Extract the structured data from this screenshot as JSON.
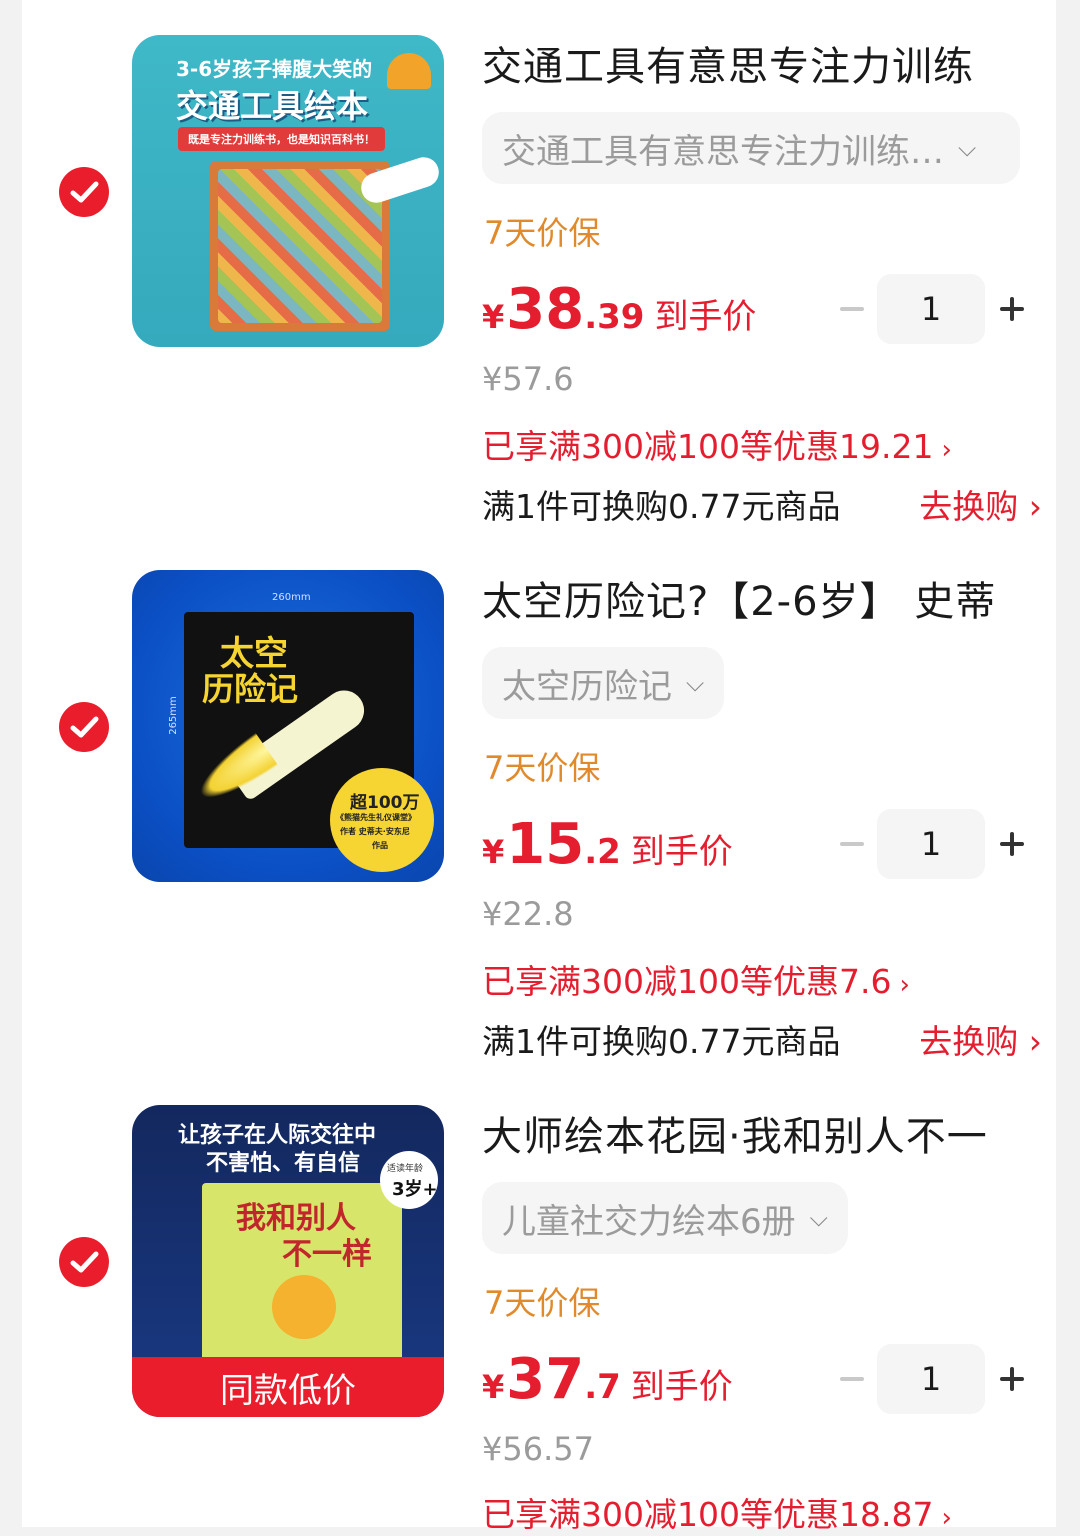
{
  "colors": {
    "accent": "#e41e2f",
    "tag": "#e08a2c",
    "muted": "#9b9b9b"
  },
  "items": [
    {
      "checked": true,
      "image": {
        "headline": "3-6岁孩子捧腹大笑的",
        "subtitle": "交通工具绘本",
        "banner": "既是专注力训练书，也是知识百科书！"
      },
      "title": "交通工具有意思专注力训练",
      "spec": "交通工具有意思专注力训练…",
      "tag": "7天价保",
      "price_yen": "¥",
      "price_int": "38",
      "price_dec": ".39",
      "price_label": "到手价",
      "quantity": "1",
      "original_price": "¥57.6",
      "promo": "已享满300减100等优惠19.21",
      "swap": "满1件可换购0.77元商品",
      "swap_action": "去换购"
    },
    {
      "checked": true,
      "image": {
        "headline": "太空",
        "subtitle": "历险记",
        "badge_line1": "超100万",
        "badge_line2": "《熊猫先生礼仪课堂》",
        "badge_line3": "作者 史蒂夫·安东尼",
        "badge_line4": "作品",
        "dim_w": "260mm",
        "dim_h": "265mm"
      },
      "title": "太空历险记?【2-6岁】 史蒂",
      "spec": "太空历险记",
      "tag": "7天价保",
      "price_yen": "¥",
      "price_int": "15",
      "price_dec": ".2",
      "price_label": "到手价",
      "quantity": "1",
      "original_price": "¥22.8",
      "promo": "已享满300减100等优惠7.6",
      "swap": "满1件可换购0.77元商品",
      "swap_action": "去换购"
    },
    {
      "checked": true,
      "image": {
        "headline": "让孩子在人际交往中",
        "subtitle": "不害怕、有自信",
        "book_title_1": "我和别人",
        "book_title_2": "不一样",
        "age_label": "适读年龄",
        "age": "3岁+",
        "ribbon": "同款低价"
      },
      "title": "大师绘本花园·我和别人不一",
      "spec": "儿童社交力绘本6册",
      "tag": "7天价保",
      "price_yen": "¥",
      "price_int": "37",
      "price_dec": ".7",
      "price_label": "到手价",
      "quantity": "1",
      "original_price": "¥56.57",
      "promo": "已享满300减100等优惠18.87"
    }
  ],
  "icons": {
    "check": "check-circle-icon",
    "chevron_down": "chevron-down-icon",
    "chevron_right": "chevron-right-icon",
    "minus": "minus-icon",
    "plus": "plus-icon"
  }
}
